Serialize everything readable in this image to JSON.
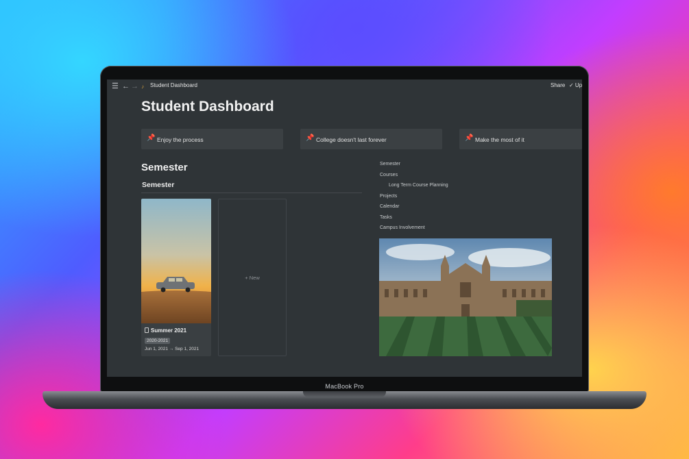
{
  "device": {
    "model_label": "MacBook Pro"
  },
  "topbar": {
    "title": "Student Dashboard",
    "share_label": "Share",
    "update_label": "✓ Up"
  },
  "page": {
    "title": "Student Dashboard"
  },
  "callouts": [
    {
      "text": "Enjoy the process"
    },
    {
      "text": "College doesn't last forever"
    },
    {
      "text": "Make the most of it"
    }
  ],
  "semester_section": {
    "heading": "Semester",
    "view_title": "Semester",
    "cards": [
      {
        "title": "Summer 2021",
        "tag": "2020-2021",
        "date_range": "Jun 1, 2021 → Sep 1, 2021"
      }
    ],
    "new_label": "+ New"
  },
  "toc": [
    {
      "label": "Semester",
      "indent": 0
    },
    {
      "label": "Courses",
      "indent": 0
    },
    {
      "label": "Long Term Course Planning",
      "indent": 1
    },
    {
      "label": "Projects",
      "indent": 0
    },
    {
      "label": "Calendar",
      "indent": 0
    },
    {
      "label": "Tasks",
      "indent": 0
    },
    {
      "label": "Campus Involvement",
      "indent": 0
    }
  ],
  "icons": {
    "menu": "menu-icon",
    "back": "arrow-left-icon",
    "forward": "arrow-right-icon",
    "pin": "pushpin-icon",
    "doc": "document-icon"
  },
  "colors": {
    "app_bg": "#2f3437",
    "callout_bg": "#3b4043",
    "card_bg": "#3a3f42",
    "pin": "#ff5b5b"
  }
}
